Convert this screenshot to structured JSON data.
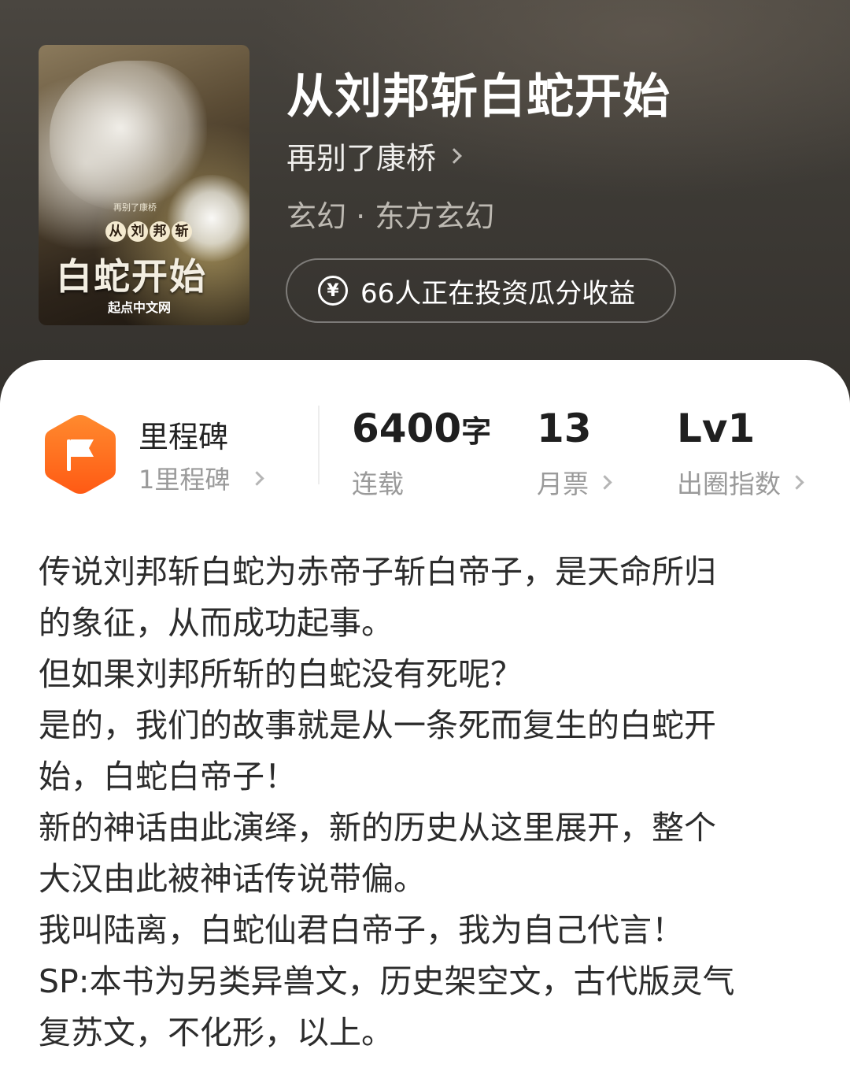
{
  "book": {
    "title": "从刘邦斩白蛇开始",
    "author": "再别了康桥",
    "genre": "玄幻 · 东方玄幻",
    "invest_text": "66人正在投资瓜分收益",
    "invest_icon": "yen-coin-icon"
  },
  "cover": {
    "author": "再别了康桥",
    "subtitle_chars": [
      "从",
      "刘",
      "邦",
      "斩"
    ],
    "title": "白蛇开始",
    "publisher": "起点中文网"
  },
  "stats": {
    "milestone": {
      "title": "里程碑",
      "subtitle": "1里程碑",
      "icon": "flag-hexagon-icon",
      "color": "#ff6a1f"
    },
    "word_count": {
      "value": "6400",
      "unit": "字",
      "label": "连载"
    },
    "monthly_votes": {
      "value": "13",
      "label": "月票"
    },
    "breakout_index": {
      "value": "Lv1",
      "label": "出圈指数"
    }
  },
  "synopsis": {
    "lines": [
      "传说刘邦斩白蛇为赤帝子斩白帝子，是天命所归",
      "的象征，从而成功起事。",
      "但如果刘邦所斩的白蛇没有死呢？",
      "是的，我们的故事就是从一条死而复生的白蛇开",
      "始，白蛇白帝子！",
      "新的神话由此演绎，新的历史从这里展开，整个",
      "大汉由此被神话传说带偏。",
      "我叫陆离，白蛇仙君白帝子，我为自己代言！",
      "SP:本书为另类异兽文，历史架空文，古代版灵气",
      "复苏文，不化形，以上。"
    ]
  }
}
